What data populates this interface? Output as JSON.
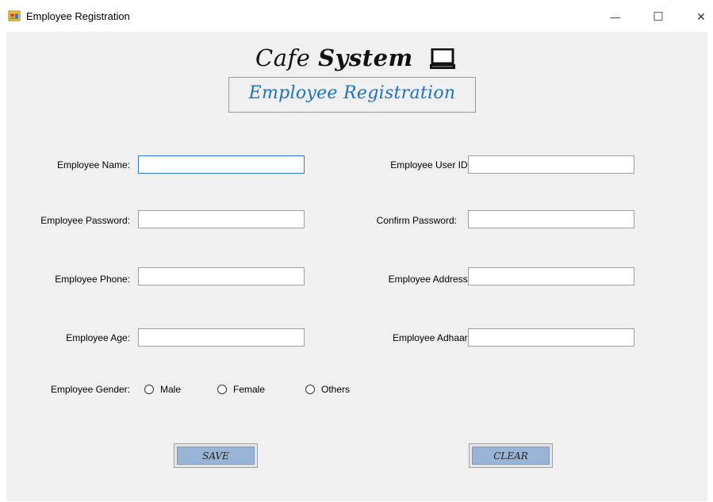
{
  "window": {
    "title": "Employee Registration",
    "minimize_symbol": "—",
    "maximize_symbol": "☐",
    "close_symbol": "✕",
    "icon": "app-form-icon"
  },
  "brand": {
    "word1": "Cafe ",
    "word2": "System",
    "icon": "laptop-icon"
  },
  "heading": "Employee Registration",
  "fields": {
    "name": {
      "label": "Employee Name:",
      "value": ""
    },
    "user_id": {
      "label": "Employee User ID:",
      "value": ""
    },
    "password": {
      "label": "Employee Password:",
      "value": ""
    },
    "confirm_password": {
      "label": "Confirm Password:",
      "value": ""
    },
    "phone": {
      "label": "Employee Phone:",
      "value": ""
    },
    "address": {
      "label": "Employee Address:",
      "value": ""
    },
    "age": {
      "label": "Employee Age:",
      "value": ""
    },
    "adhaar": {
      "label": "Employee Adhaar:",
      "value": ""
    }
  },
  "gender": {
    "label": "Employee Gender:",
    "options": [
      "Male",
      "Female",
      "Others"
    ]
  },
  "buttons": {
    "save": "SAVE",
    "clear": "CLEAR"
  },
  "colors": {
    "heading": "#1a73c8",
    "button_face": "#98b4d6",
    "background": "#f0f0f0"
  }
}
